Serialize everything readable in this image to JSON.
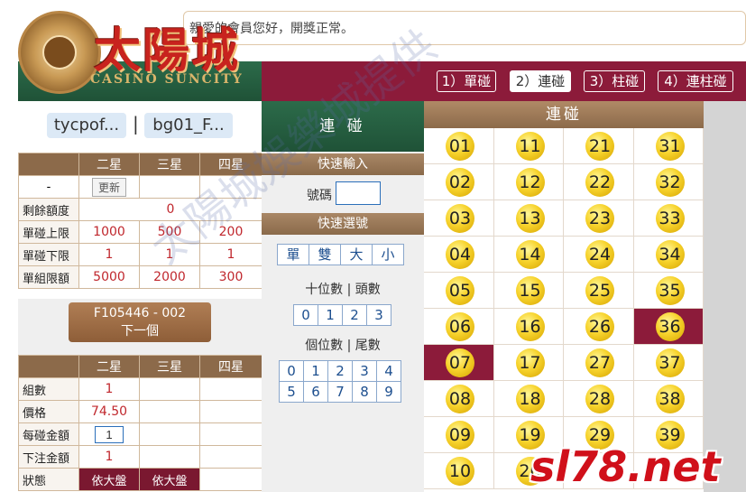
{
  "marquee": {
    "text": "親愛的會員您好，開獎正常。"
  },
  "logo": {
    "title": "太陽城",
    "subtitle": "CASINO SUNCITY",
    "emblem_icon": "sun-emblem-icon"
  },
  "tabs": [
    {
      "label": "1）單碰",
      "active": false
    },
    {
      "label": "2）連碰",
      "active": true
    },
    {
      "label": "3）柱碰",
      "active": false
    },
    {
      "label": "4）連柱碰",
      "active": false
    }
  ],
  "user": {
    "name": "tycpof...",
    "sep": "|",
    "account": "bg01_F..."
  },
  "limits": {
    "headers": [
      "",
      "二星",
      "三星",
      "四星"
    ],
    "refresh_label": "更新",
    "refresh_row_label": "-",
    "remaining_label": "剩餘額度",
    "remaining_value": "0",
    "rows": [
      {
        "label": "單碰上限",
        "values": [
          "1000",
          "500",
          "200"
        ]
      },
      {
        "label": "單碰下限",
        "values": [
          "1",
          "1",
          "1"
        ]
      },
      {
        "label": "單組限額",
        "values": [
          "5000",
          "2000",
          "300"
        ]
      }
    ]
  },
  "next": {
    "code": "F105446 - 002",
    "label": "下一個"
  },
  "bet": {
    "headers": [
      "",
      "二星",
      "三星",
      "四星"
    ],
    "groups_label": "組數",
    "groups_value": "1",
    "price_label": "價格",
    "price_value": "74.50",
    "amount_label": "每碰金額",
    "amount_value": "1",
    "total_label": "下注金額",
    "total_value": "1",
    "status_label": "狀態",
    "status_values": [
      "依大盤",
      "依大盤"
    ]
  },
  "mid": {
    "title": "連 碰",
    "quick_input_title": "快速輸入",
    "number_label": "號碼",
    "quick_select_title": "快速選號",
    "quick_buttons": [
      "單",
      "雙",
      "大",
      "小"
    ],
    "tens_label": "十位數 | 頭數",
    "tens_buttons": [
      "0",
      "1",
      "2",
      "3"
    ],
    "units_label": "個位數 | 尾數",
    "units_row1": [
      "0",
      "1",
      "2",
      "3",
      "4"
    ],
    "units_row2": [
      "5",
      "6",
      "7",
      "8",
      "9"
    ]
  },
  "grid": {
    "title": "連碰",
    "selected": [
      "07",
      "36"
    ],
    "rows": [
      [
        "01",
        "11",
        "21",
        "31"
      ],
      [
        "02",
        "12",
        "22",
        "32"
      ],
      [
        "03",
        "13",
        "23",
        "33"
      ],
      [
        "04",
        "14",
        "24",
        "34"
      ],
      [
        "05",
        "15",
        "25",
        "35"
      ],
      [
        "06",
        "16",
        "26",
        "36"
      ],
      [
        "07",
        "17",
        "27",
        "37"
      ],
      [
        "08",
        "18",
        "28",
        "38"
      ],
      [
        "09",
        "19",
        "29",
        "39"
      ],
      [
        "10",
        "20",
        "",
        ""
      ]
    ]
  },
  "watermark": {
    "text": "太陽城娛樂城提供"
  },
  "stamp": {
    "text": "sl78.net"
  },
  "colors": {
    "maroon": "#8c1b3a",
    "green": "#2c6b4a",
    "brown": "#8c6a4a",
    "ball": "#f7d32c"
  }
}
